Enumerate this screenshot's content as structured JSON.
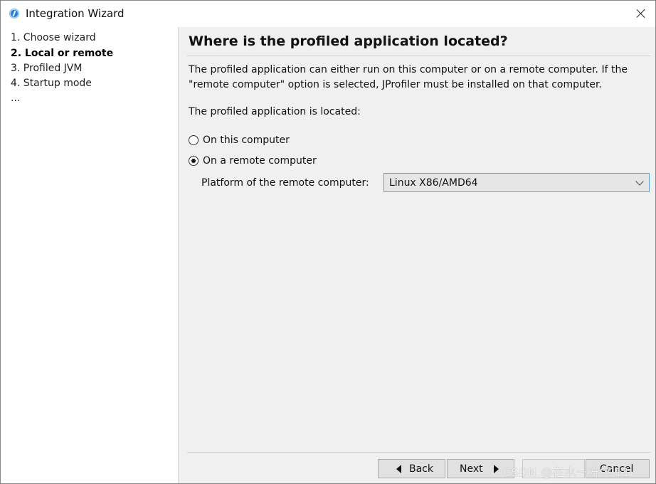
{
  "window": {
    "title": "Integration Wizard",
    "icon": "jprofiler-app-icon",
    "close_icon": "close-icon"
  },
  "steps": [
    {
      "label": "1. Choose wizard",
      "active": false
    },
    {
      "label": "2. Local or remote",
      "active": true
    },
    {
      "label": "3. Profiled JVM",
      "active": false
    },
    {
      "label": "4. Startup mode",
      "active": false
    },
    {
      "label": "...",
      "active": false
    }
  ],
  "content": {
    "heading": "Where is the profiled application located?",
    "description_line1": "The profiled application can either run on this computer or on a remote computer. If the",
    "description_line2": "\"remote computer\" option is selected, JProfiler must be installed on that computer.",
    "located_label": "The profiled application is located:",
    "options": [
      {
        "label": "On this computer",
        "selected": false
      },
      {
        "label": "On a remote computer",
        "selected": true
      }
    ],
    "platform_label": "Platform of the remote computer:",
    "platform_value": "Linux X86/AMD64"
  },
  "buttons": {
    "back": "Back",
    "next": "Next",
    "cancel": "Cancel"
  },
  "watermark": "CSDN @在水一方0911",
  "colors": {
    "accent": "#5aa0dc",
    "panel_bg": "#f0f0f0"
  }
}
